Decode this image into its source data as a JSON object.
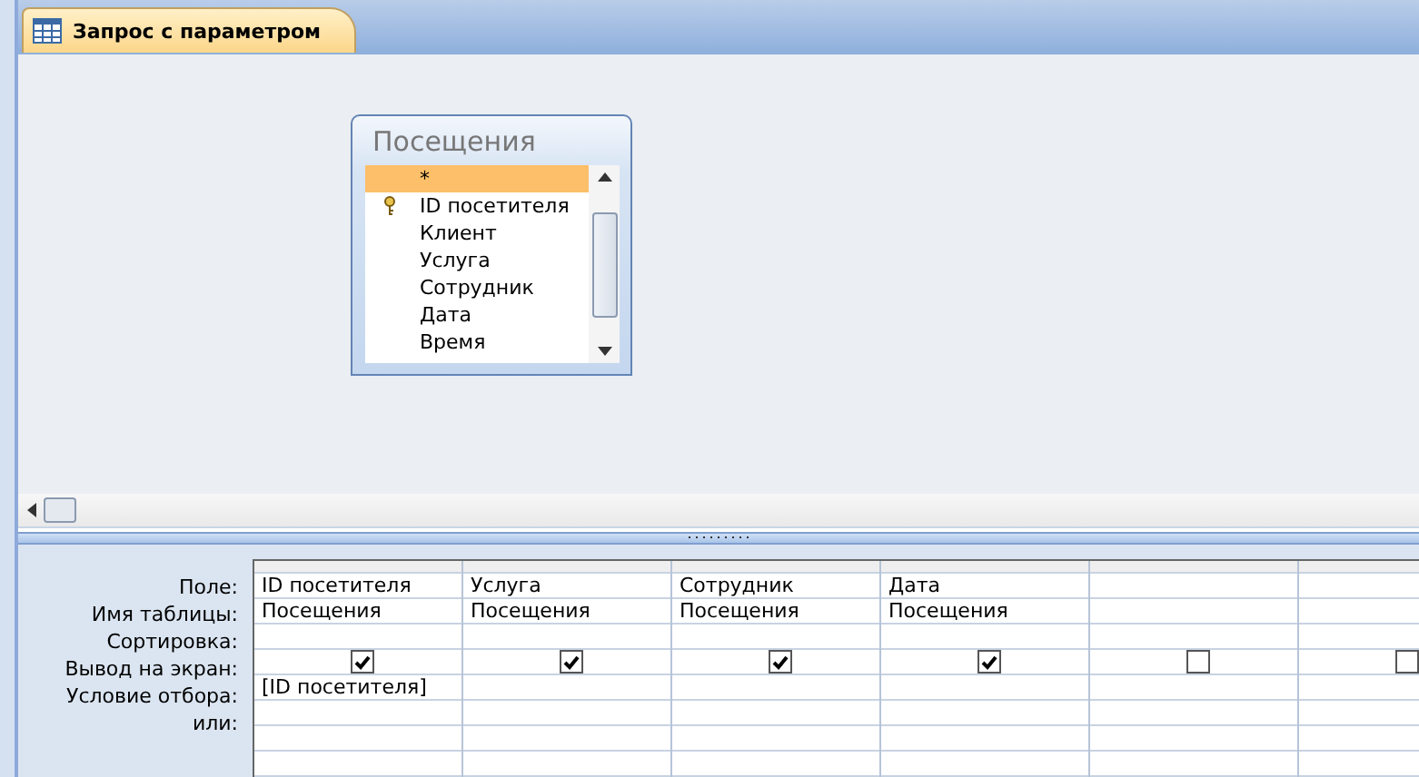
{
  "document_tab": {
    "title": "Запрос с параметром",
    "selected": true
  },
  "table_box": {
    "title": "Посещения",
    "fields": [
      {
        "name": "*",
        "selected": true,
        "primary_key": false
      },
      {
        "name": "ID посетителя",
        "selected": false,
        "primary_key": true
      },
      {
        "name": "Клиент",
        "selected": false,
        "primary_key": false
      },
      {
        "name": "Услуга",
        "selected": false,
        "primary_key": false
      },
      {
        "name": "Сотрудник",
        "selected": false,
        "primary_key": false
      },
      {
        "name": "Дата",
        "selected": false,
        "primary_key": false
      },
      {
        "name": "Время",
        "selected": false,
        "primary_key": false
      }
    ]
  },
  "query_grid": {
    "row_labels": [
      "Поле:",
      "Имя таблицы:",
      "Сортировка:",
      "Вывод на экран:",
      "Условие отбора:",
      "или:"
    ],
    "columns": [
      {
        "field": "ID посетителя",
        "table": "Посещения",
        "show": true,
        "criteria": "[ID посетителя]"
      },
      {
        "field": "Услуга",
        "table": "Посещения",
        "show": true
      },
      {
        "field": "Сотрудник",
        "table": "Посещения",
        "show": true
      },
      {
        "field": "Дата",
        "table": "Посещения",
        "show": true
      },
      {
        "show": false
      },
      {
        "show": false
      }
    ]
  }
}
